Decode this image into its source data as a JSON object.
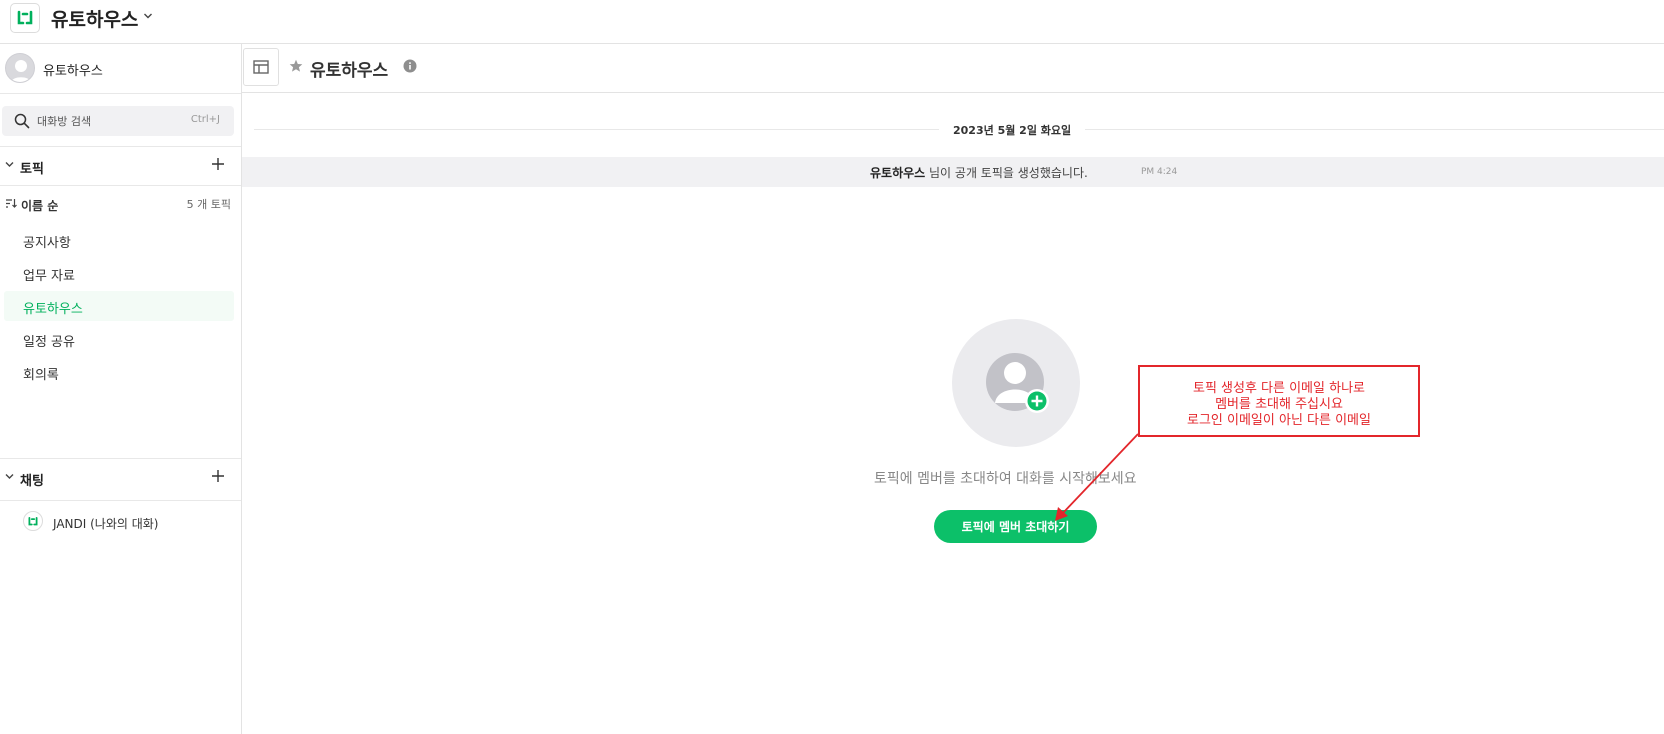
{
  "header": {
    "team_name": "유토하우스"
  },
  "sidebar": {
    "profile_name": "유토하우스",
    "search": {
      "placeholder": "대화방 검색",
      "shortcut": "Ctrl+J"
    },
    "topics_section": {
      "label": "토픽"
    },
    "sort": {
      "label": "이름 순",
      "count": "5 개 토픽"
    },
    "topics": [
      {
        "label": "공지사항"
      },
      {
        "label": "업무 자료"
      },
      {
        "label": "유토하우스",
        "active": true
      },
      {
        "label": "일정 공유"
      },
      {
        "label": "회의록"
      }
    ],
    "chat_section": {
      "label": "채팅"
    },
    "chats": [
      {
        "label": "JANDI (나와의 대화)"
      }
    ]
  },
  "main": {
    "topic_title": "유토하우스",
    "date_divider": "2023년 5월 2일 화요일",
    "system_message": {
      "author": "유토하우스",
      "text": " 님이 공개 토픽을 생성했습니다.",
      "time": "PM 4:24"
    },
    "empty_state": {
      "text": "토픽에 멤버를 초대하여 대화를 시작해보세요",
      "button_label": "토픽에 멤버 초대하기"
    }
  },
  "annotation": {
    "lines": [
      "토픽 생성후 다른 이메일 하나로",
      "멤버를 초대해 주십시요",
      "로그인 이메일이 아닌 다른 이메일"
    ],
    "color": "#e3262b"
  },
  "colors": {
    "brand_green": "#0cc069",
    "active_text": "#00b05c"
  }
}
